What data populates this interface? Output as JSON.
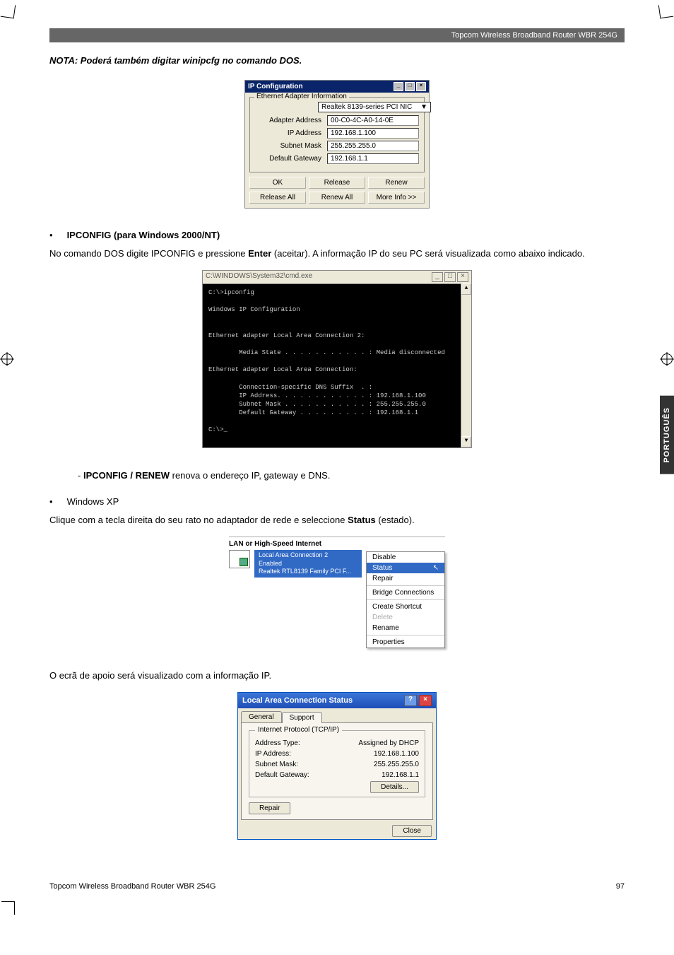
{
  "header": {
    "product": "Topcom Wireless Broadband Router WBR 254G"
  },
  "nota": "NOTA: Poderá também digitar winipcfg no comando DOS.",
  "ipcfg": {
    "title": "IP Configuration",
    "group": "Ethernet Adapter Information",
    "adapter_select": "Realtek 8139-series PCI NIC",
    "fields": {
      "adapter_address_label": "Adapter Address",
      "adapter_address": "00-C0-4C-A0-14-0E",
      "ip_label": "IP Address",
      "ip": "192.168.1.100",
      "mask_label": "Subnet Mask",
      "mask": "255.255.255.0",
      "gw_label": "Default Gateway",
      "gw": "192.168.1.1"
    },
    "buttons": {
      "ok": "OK",
      "release": "Release",
      "renew": "Renew",
      "release_all": "Release All",
      "renew_all": "Renew All",
      "more": "More Info >>"
    }
  },
  "section1": {
    "bullet": "•",
    "heading": "IPCONFIG (para Windows 2000/NT)",
    "body_pre": "No comando DOS digite IPCONFIG e pressione ",
    "enter": "Enter",
    "body_post": " (aceitar). A informação IP do seu PC será visualizada como abaixo indicado."
  },
  "cmd": {
    "title": "C:\\WINDOWS\\System32\\cmd.exe",
    "lines": "C:\\>ipconfig\n\nWindows IP Configuration\n\n\nEthernet adapter Local Area Connection 2:\n\n        Media State . . . . . . . . . . . : Media disconnected\n\nEthernet adapter Local Area Connection:\n\n        Connection-specific DNS Suffix  . :\n        IP Address. . . . . . . . . . . . : 192.168.1.100\n        Subnet Mask . . . . . . . . . . . : 255.255.255.0\n        Default Gateway . . . . . . . . . : 192.168.1.1\n\nC:\\>_"
  },
  "renew": {
    "bullet": "- ",
    "bold": "IPCONFIG / RENEW",
    "rest": " renova o endereço IP, gateway e DNS."
  },
  "winxp": {
    "bullet": "•",
    "label": "Windows XP",
    "body_pre": "Clique com a tecla direita do seu rato no adaptador de rede e seleccione ",
    "status": "Status",
    "body_post": " (estado)."
  },
  "lan": {
    "group": "LAN or High-Speed Internet",
    "line1": "Local Area Connection 2",
    "line2": "Enabled",
    "line3": "Realtek RTL8139 Family PCI F...",
    "menu": {
      "disable": "Disable",
      "status": "Status",
      "repair": "Repair",
      "bridge": "Bridge Connections",
      "shortcut": "Create Shortcut",
      "delete": "Delete",
      "rename": "Rename",
      "properties": "Properties"
    }
  },
  "support_intro": "O ecrã de apoio será visualizado com a informação IP.",
  "status": {
    "title": "Local Area Connection Status",
    "tab_general": "General",
    "tab_support": "Support",
    "fieldset": "Internet Protocol (TCP/IP)",
    "rows": {
      "addr_type_l": "Address Type:",
      "addr_type_v": "Assigned by DHCP",
      "ip_l": "IP Address:",
      "ip_v": "192.168.1.100",
      "mask_l": "Subnet Mask:",
      "mask_v": "255.255.255.0",
      "gw_l": "Default Gateway:",
      "gw_v": "192.168.1.1"
    },
    "details": "Details...",
    "repair": "Repair",
    "close": "Close"
  },
  "side_tab": "PORTUGUÊS",
  "footer": {
    "left": "Topcom Wireless Broadband Router WBR 254G",
    "right": "97"
  }
}
